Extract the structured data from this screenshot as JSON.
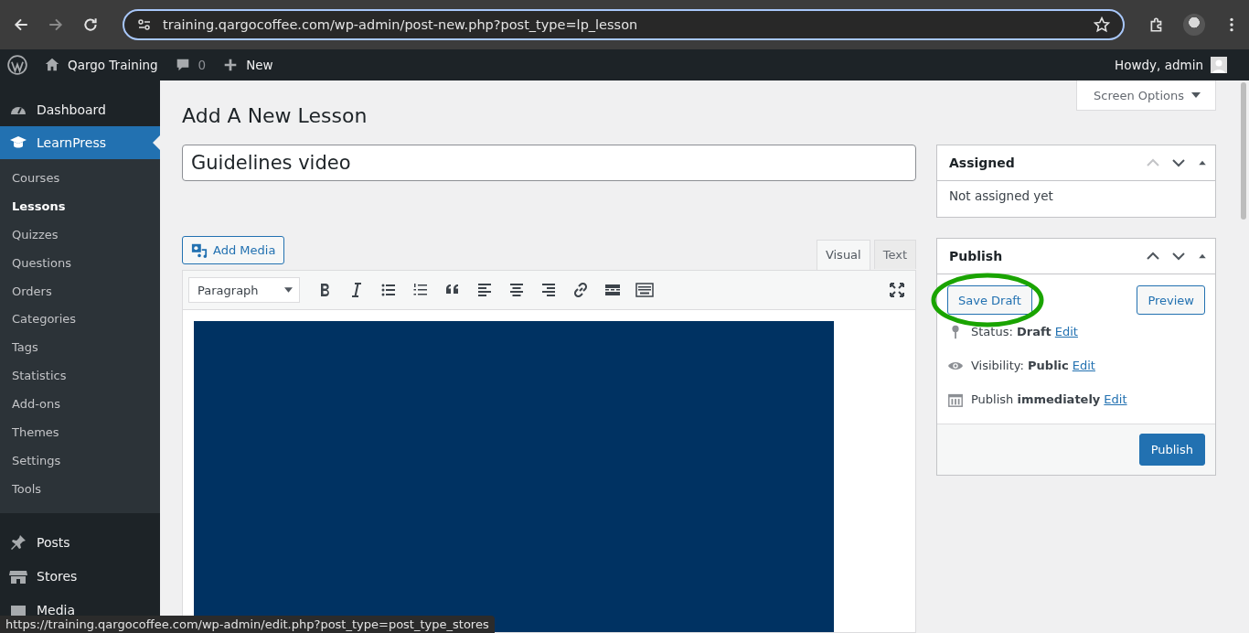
{
  "browser": {
    "url": "training.qargocoffee.com/wp-admin/post-new.php?post_type=lp_lesson",
    "status_url": "https://training.qargocoffee.com/wp-admin/edit.php?post_type=post_type_stores"
  },
  "admin_bar": {
    "site": "Qargo Training",
    "comments": "0",
    "new": "New",
    "greeting": "Howdy, admin"
  },
  "sidebar": {
    "top": [
      {
        "label": "Dashboard",
        "kind": "dashboard",
        "selected": false
      },
      {
        "label": "LearnPress",
        "kind": "cap",
        "selected": true
      }
    ],
    "submenu": [
      {
        "label": "Courses",
        "selected": false
      },
      {
        "label": "Lessons",
        "selected": true
      },
      {
        "label": "Quizzes",
        "selected": false
      },
      {
        "label": "Questions",
        "selected": false
      },
      {
        "label": "Orders",
        "selected": false
      },
      {
        "label": "Categories",
        "selected": false
      },
      {
        "label": "Tags",
        "selected": false
      },
      {
        "label": "Statistics",
        "selected": false
      },
      {
        "label": "Add-ons",
        "selected": false
      },
      {
        "label": "Themes",
        "selected": false
      },
      {
        "label": "Settings",
        "selected": false
      },
      {
        "label": "Tools",
        "selected": false
      }
    ],
    "bottom": [
      {
        "label": "Posts",
        "kind": "pin",
        "selected": false
      },
      {
        "label": "Stores",
        "kind": "store",
        "selected": false
      },
      {
        "label": "Media",
        "kind": "media",
        "selected": false
      }
    ]
  },
  "page": {
    "title": "Add A New Lesson",
    "screen_options": "Screen Options",
    "post_title": "Guidelines video"
  },
  "editor": {
    "add_media": "Add Media",
    "tabs": [
      {
        "label": "Visual",
        "selected": true
      },
      {
        "label": "Text",
        "selected": false
      }
    ],
    "format": "Paragraph",
    "tools": [
      {
        "kind": "bold"
      },
      {
        "kind": "italic"
      },
      {
        "kind": "bullets"
      },
      {
        "kind": "numbers"
      },
      {
        "kind": "quote"
      },
      {
        "kind": "align-left"
      },
      {
        "kind": "align-center"
      },
      {
        "kind": "align-right"
      },
      {
        "kind": "link"
      },
      {
        "kind": "more"
      },
      {
        "kind": "toolbar"
      }
    ]
  },
  "assigned": {
    "title": "Assigned",
    "text": "Not assigned yet"
  },
  "publish": {
    "title": "Publish",
    "save_draft": "Save Draft",
    "save_draft_highlighted": true,
    "preview": "Preview",
    "rows": [
      {
        "kind": "pin",
        "text": "Status: **Draft**",
        "link": "Edit"
      },
      {
        "kind": "eye",
        "text": "Visibility: **Public**",
        "link": "Edit"
      },
      {
        "kind": "calendar",
        "text": "Publish **immediately**",
        "link": "Edit"
      }
    ],
    "button": "Publish"
  }
}
